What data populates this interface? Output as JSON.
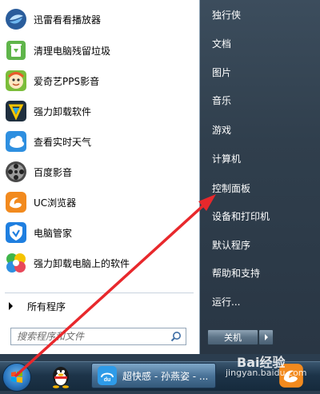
{
  "left_menu": {
    "items": [
      {
        "label": "迅雷看看播放器",
        "icon": "xunlei-player-icon"
      },
      {
        "label": "清理电脑残留垃圾",
        "icon": "recycle-bin-icon"
      },
      {
        "label": "爱奇艺PPS影音",
        "icon": "pps-player-icon"
      },
      {
        "label": "强力卸载软件",
        "icon": "uninstaller-icon"
      },
      {
        "label": "查看实时天气",
        "icon": "weather-icon"
      },
      {
        "label": "百度影音",
        "icon": "baidu-player-icon"
      },
      {
        "label": "UC浏览器",
        "icon": "uc-browser-icon"
      },
      {
        "label": "电脑管家",
        "icon": "pc-manager-shield-icon"
      },
      {
        "label": "强力卸载电脑上的软件",
        "icon": "uninstall-pinwheel-icon"
      }
    ],
    "all_programs": "所有程序",
    "search_placeholder": "搜索程序和文件"
  },
  "right_menu": {
    "items": [
      "独行侠",
      "文档",
      "图片",
      "音乐",
      "游戏",
      "计算机",
      "控制面板",
      "设备和打印机",
      "默认程序",
      "帮助和支持",
      "运行..."
    ],
    "shutdown_label": "关机"
  },
  "taskbar": {
    "active_task_label": "超快感 - 孙燕姿 - ..."
  },
  "watermark": {
    "word": "Bai经验",
    "url": "jingyan.baidu.com"
  },
  "colors": {
    "arrow": "#e8282c",
    "right_pane": "#34444f",
    "left_pane": "#ffffff"
  }
}
